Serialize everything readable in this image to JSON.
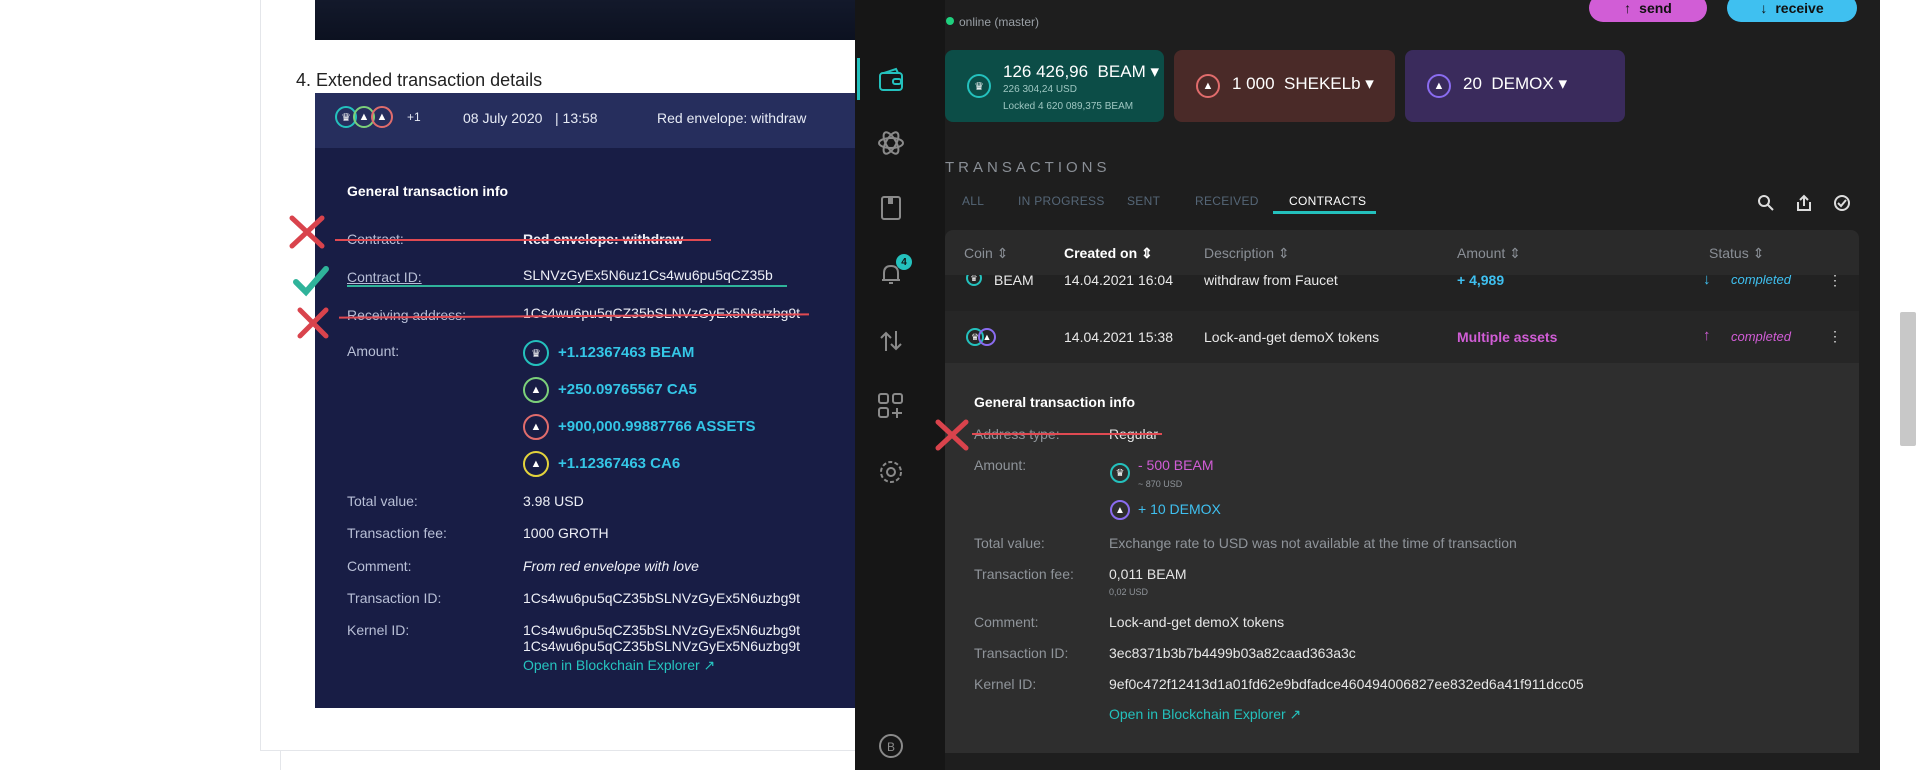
{
  "document": {
    "heading": "4. Extended transaction details",
    "mock": {
      "coin_more": "+1",
      "date": "08 July 2020",
      "time": "| 13:58",
      "title": "Red envelope: withdraw",
      "section_title": "General transaction info",
      "rows": [
        {
          "label": "Contract:",
          "value": "Red envelope: withdraw"
        },
        {
          "label": "Contract ID:",
          "value": "SLNVzGyEx5N6uz1Cs4wu6pu5qCZ35b"
        },
        {
          "label": "Receiving address:",
          "value": "1Cs4wu6pu5qCZ35bSLNVzGyEx5N6uzbg9t"
        },
        {
          "label": "Amount:",
          "value": ""
        }
      ],
      "amounts": [
        "+1.12367463 BEAM",
        "+250.09765567 CA5",
        "+900,000.99887766 ASSETS",
        "+1.12367463 CA6"
      ],
      "total_value_label": "Total value:",
      "total_value": "3.98 USD",
      "fee_label": "Transaction fee:",
      "fee": "1000 GROTH",
      "comment_label": "Comment:",
      "comment": "From red envelope with love",
      "txid_label": "Transaction ID:",
      "txid": "1Cs4wu6pu5qCZ35bSLNVzGyEx5N6uzbg9t",
      "kernel_label": "Kernel ID:",
      "kernel_line1": "1Cs4wu6pu5qCZ35bSLNVzGyEx5N6uzbg9t",
      "kernel_line2": "1Cs4wu6pu5qCZ35bSLNVzGyEx5N6uzbg9t",
      "explorer": "Open in Blockchain Explorer"
    }
  },
  "wallet": {
    "status": "online (master)",
    "send_label": "send",
    "receive_label": "receive",
    "notification_count": "4",
    "assets": [
      {
        "amount": "126 426,96",
        "unit": "BEAM",
        "usd": "226 304,24 USD",
        "locked": "Locked  4 620 089,375  BEAM",
        "color": "#0c4d47"
      },
      {
        "amount": "1 000",
        "unit": "SHEKELb",
        "color": "#4a2a28"
      },
      {
        "amount": "20",
        "unit": "DEMOX",
        "color": "#3a2b5c"
      }
    ],
    "transactions_title": "TRANSACTIONS",
    "tabs": [
      "ALL",
      "IN PROGRESS",
      "SENT",
      "RECEIVED",
      "CONTRACTS"
    ],
    "active_tab": "CONTRACTS",
    "columns": [
      "Coin",
      "Created on",
      "Description",
      "Amount",
      "Status"
    ],
    "rows": [
      {
        "coin": "BEAM",
        "created": "14.04.2021 16:04",
        "description": "withdraw from Faucet",
        "amount": "+ 4,989",
        "status": "completed"
      },
      {
        "coin": "",
        "created": "14.04.2021 15:38",
        "description": "Lock-and-get demoX tokens",
        "amount": "Multiple assets",
        "status": "completed"
      }
    ],
    "details": {
      "title": "General transaction info",
      "address_type_label": "Address type:",
      "address_type": "Regular",
      "amount_label": "Amount:",
      "amount1": "- 500  BEAM",
      "amount1_usd": "~ 870 USD",
      "amount2": "+ 10  DEMOX",
      "total_label": "Total value:",
      "total": "Exchange rate to USD was not available at the time of transaction",
      "fee_label": "Transaction fee:",
      "fee": "0,011  BEAM",
      "fee_usd": "0,02 USD",
      "comment_label": "Comment:",
      "comment": "Lock-and-get demoX tokens",
      "txid_label": "Transaction ID:",
      "txid": "3ec8371b3b7b4499b03a82caad363a3c",
      "kernel_label": "Kernel ID:",
      "kernel": "9ef0c472f12413d1a01fd62e9bdfadce460494006827ee832ed6a41f911dcc05",
      "explorer": "Open in Blockchain Explorer"
    },
    "colors": {
      "accent": "#24c1bd",
      "purple": "#d15dd6",
      "blue": "#3fc0f0",
      "red_mark": "#d9434c",
      "green_mark": "#2fb39a"
    }
  }
}
